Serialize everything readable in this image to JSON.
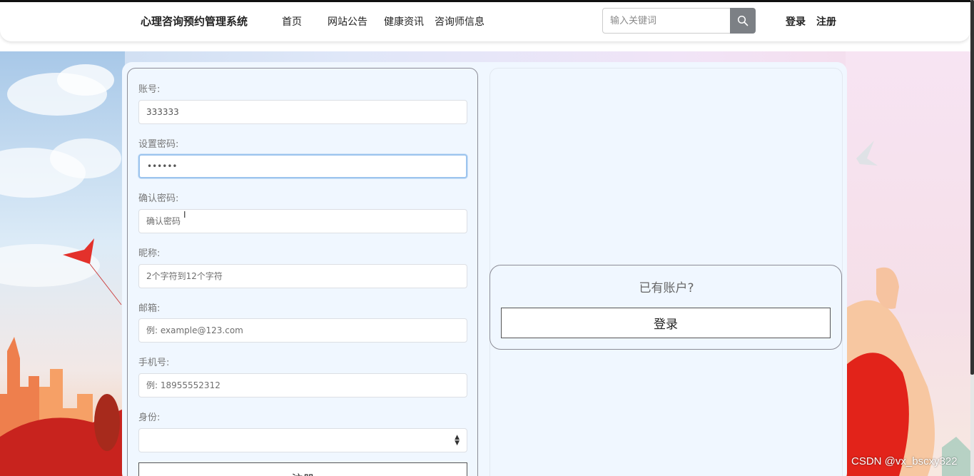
{
  "header": {
    "brand": "心理咨询预约管理系统",
    "nav": [
      "首页",
      "网站公告",
      "健康资讯",
      "咨询师信息"
    ],
    "search_placeholder": "输入关键词",
    "login": "登录",
    "register": "注册"
  },
  "form": {
    "account_label": "账号:",
    "account_value": "333333",
    "password_label": "设置密码:",
    "password_value": "••••••",
    "confirm_label": "确认密码:",
    "confirm_placeholder": "确认密码",
    "nickname_label": "昵称:",
    "nickname_placeholder": "2个字符到12个字符",
    "email_label": "邮箱:",
    "email_placeholder": "例: example@123.com",
    "phone_label": "手机号:",
    "phone_placeholder": "例: 18955552312",
    "role_label": "身份:",
    "role_value": "",
    "register_button": "注册"
  },
  "side": {
    "have_account": "已有账户?",
    "login_button": "登录"
  },
  "watermark": "CSDN @vx_bscxy322",
  "colors": {
    "panel_bg": "#f0f7ff",
    "search_button": "#7c8085",
    "focus_border": "#9cc4ee"
  }
}
